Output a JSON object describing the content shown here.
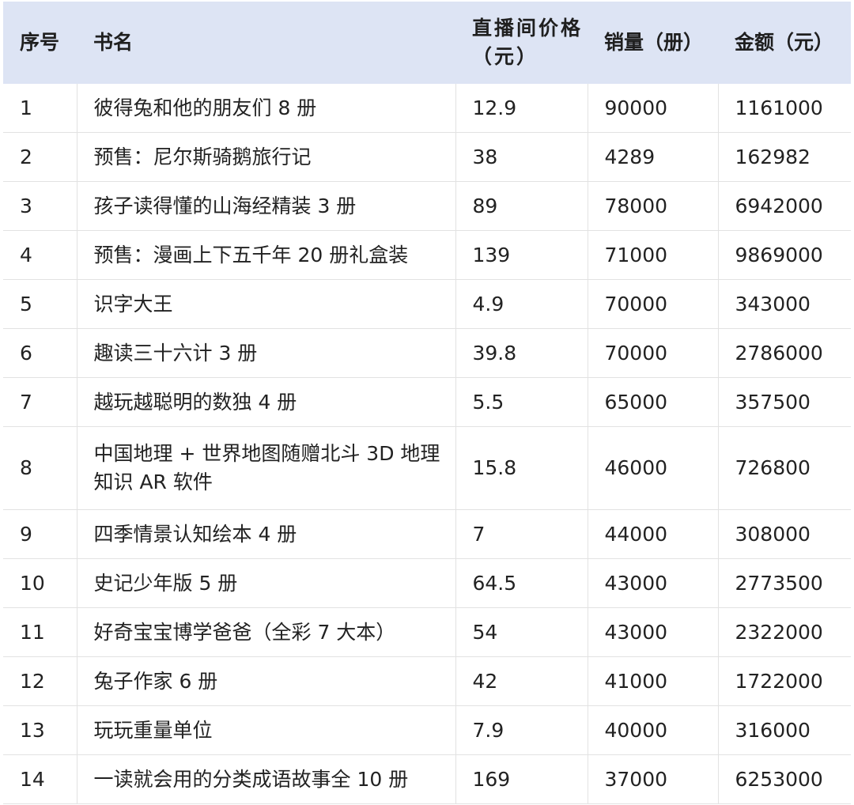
{
  "table": {
    "headers": {
      "no": "序号",
      "name": "书名",
      "price": "直播间价格（元）",
      "qty": "销量（册）",
      "amount": "金额（元）"
    },
    "rows": [
      {
        "no": "1",
        "name": "彼得兔和他的朋友们 8 册",
        "price": "12.9",
        "qty": "90000",
        "amount": "1161000"
      },
      {
        "no": "2",
        "name": "预售：尼尔斯骑鹅旅行记",
        "price": "38",
        "qty": "4289",
        "amount": "162982"
      },
      {
        "no": "3",
        "name": "孩子读得懂的山海经精装 3 册",
        "price": "89",
        "qty": "78000",
        "amount": "6942000"
      },
      {
        "no": "4",
        "name": "预售：漫画上下五千年 20 册礼盒装",
        "price": "139",
        "qty": "71000",
        "amount": "9869000"
      },
      {
        "no": "5",
        "name": "识字大王",
        "price": "4.9",
        "qty": "70000",
        "amount": "343000"
      },
      {
        "no": "6",
        "name": "趣读三十六计 3 册",
        "price": "39.8",
        "qty": "70000",
        "amount": "2786000"
      },
      {
        "no": "7",
        "name": "越玩越聪明的数独 4 册",
        "price": "5.5",
        "qty": "65000",
        "amount": "357500"
      },
      {
        "no": "8",
        "name": "中国地理 + 世界地图随赠北斗 3D 地理知识 AR 软件",
        "price": "15.8",
        "qty": "46000",
        "amount": "726800"
      },
      {
        "no": "9",
        "name": "四季情景认知绘本 4 册",
        "price": "7",
        "qty": "44000",
        "amount": "308000"
      },
      {
        "no": "10",
        "name": "史记少年版 5 册",
        "price": "64.5",
        "qty": "43000",
        "amount": "2773500"
      },
      {
        "no": "11",
        "name": "好奇宝宝博学爸爸（全彩 7 大本）",
        "price": "54",
        "qty": "43000",
        "amount": "2322000"
      },
      {
        "no": "12",
        "name": "兔子作家 6 册",
        "price": "42",
        "qty": "41000",
        "amount": "1722000"
      },
      {
        "no": "13",
        "name": "玩玩重量单位",
        "price": "7.9",
        "qty": "40000",
        "amount": "316000"
      },
      {
        "no": "14",
        "name": "一读就会用的分类成语故事全 10 册",
        "price": "169",
        "qty": "37000",
        "amount": "6253000"
      }
    ]
  },
  "colors": {
    "header_bg": "#dde4f4",
    "grid_line": "#e2e2e2",
    "text": "#222222"
  }
}
